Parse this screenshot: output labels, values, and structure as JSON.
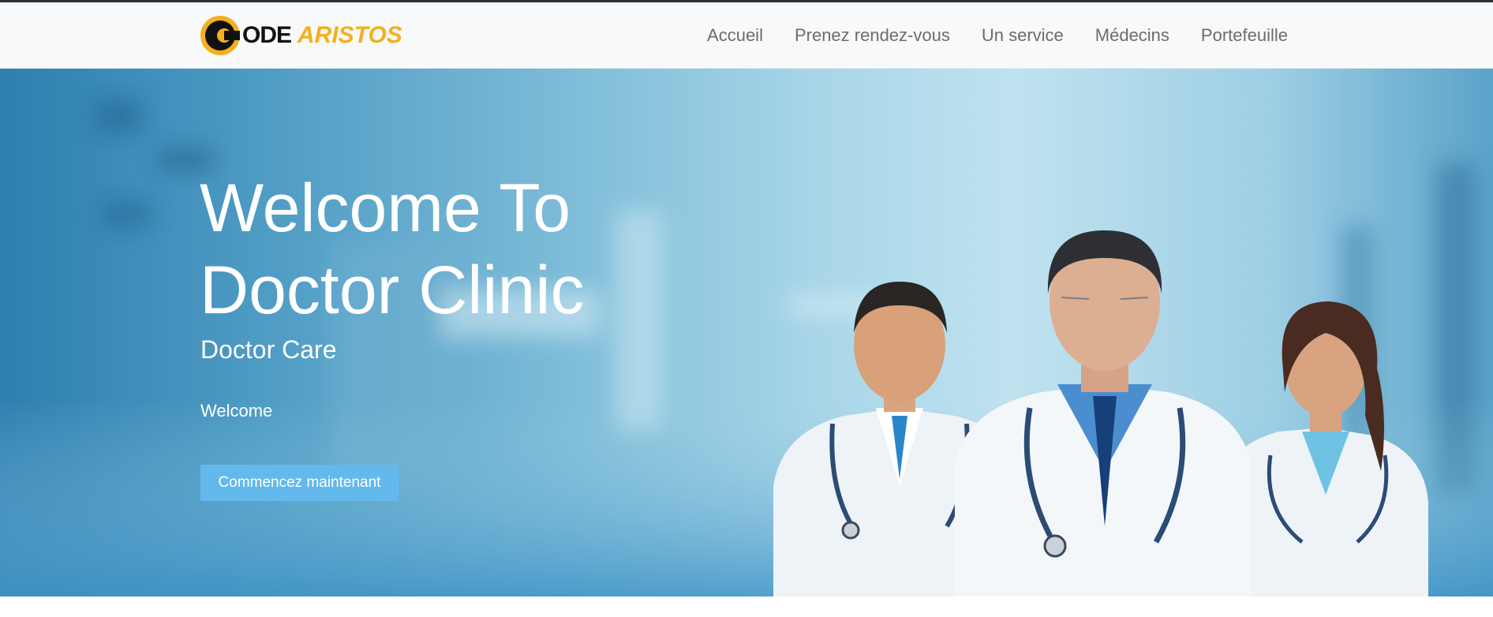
{
  "brand": {
    "logo_part1": "ODE",
    "logo_part2": "ARISTOS",
    "logo_letter": "C",
    "accent_color": "#f2b01e"
  },
  "nav": {
    "items": [
      {
        "label": "Accueil"
      },
      {
        "label": "Prenez rendez-vous"
      },
      {
        "label": "Un service"
      },
      {
        "label": "Médecins"
      },
      {
        "label": "Portefeuille"
      }
    ]
  },
  "hero": {
    "title_line1": "Welcome To",
    "title_line2": "Doctor Clinic",
    "subtitle": "Doctor Care",
    "text": "Welcome",
    "cta_label": "Commencez maintenant",
    "cta_color": "#63b9ec"
  },
  "icons": [
    "logo-mark",
    "doctors-photo"
  ]
}
